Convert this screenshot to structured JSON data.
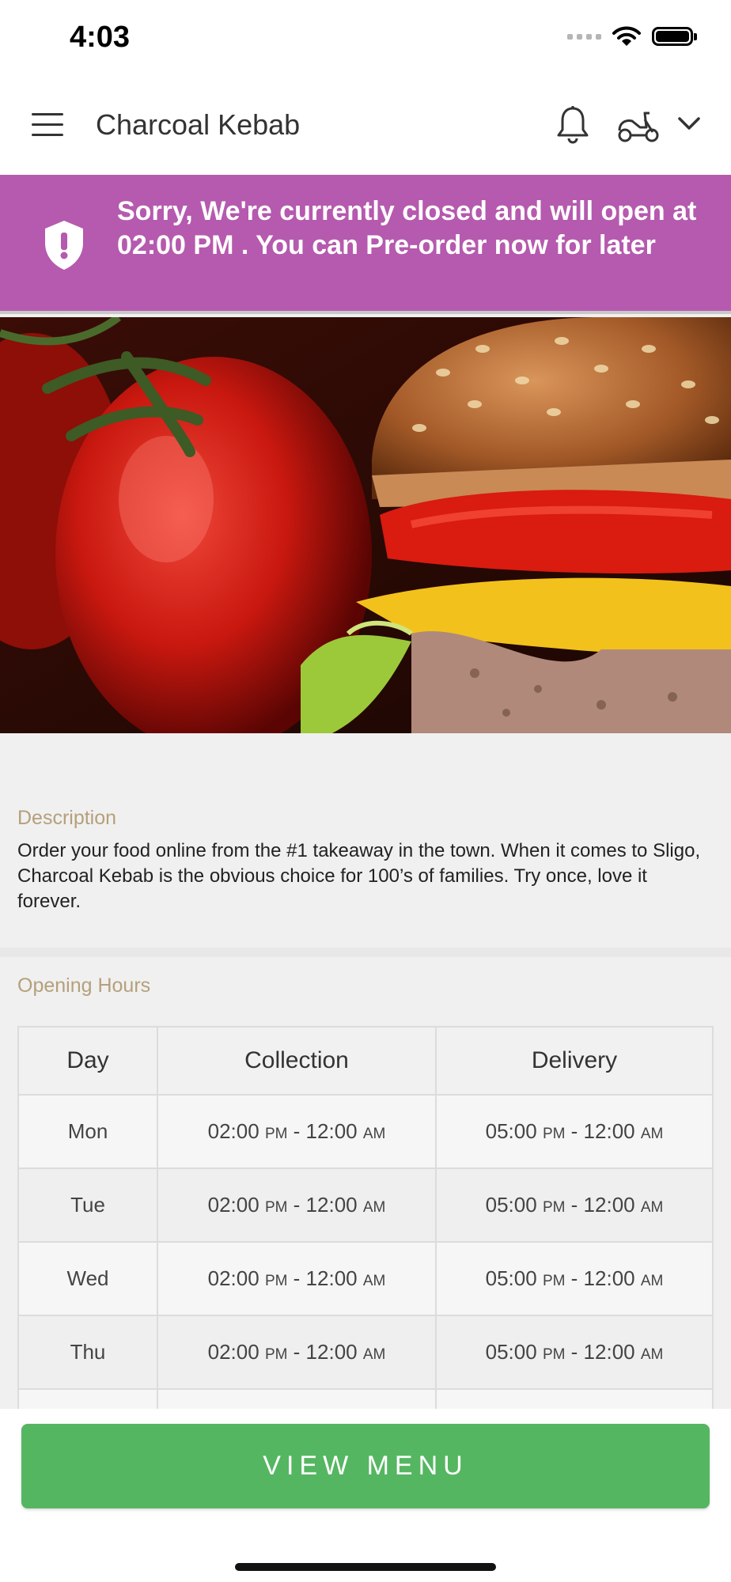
{
  "status_bar": {
    "time": "4:03",
    "icons": [
      "signal-icon",
      "wifi-icon",
      "battery-icon"
    ]
  },
  "header": {
    "title": "Charcoal Kebab",
    "icons": [
      "hamburger-menu-icon",
      "bell-icon",
      "scooter-icon",
      "chevron-down-icon"
    ]
  },
  "banner": {
    "text": "Sorry, We're currently closed and will open at 02:00 PM . You can Pre-order now for later",
    "icon": "shield-alert-icon",
    "color": "#b55aae"
  },
  "description": {
    "label": "Description",
    "text": "Order your food online from the #1 takeaway in the town. When it comes to Sligo, Charcoal Kebab is the obvious choice for 100’s of families. Try once, love it forever."
  },
  "opening_hours": {
    "label": "Opening Hours",
    "headers": [
      "Day",
      "Collection",
      "Delivery"
    ],
    "rows": [
      {
        "day": "Mon",
        "c_start": "02:00",
        "c_start_ap": "PM",
        "c_end": "12:00",
        "c_end_ap": "AM",
        "d_start": "05:00",
        "d_start_ap": "PM",
        "d_end": "12:00",
        "d_end_ap": "AM"
      },
      {
        "day": "Tue",
        "c_start": "02:00",
        "c_start_ap": "PM",
        "c_end": "12:00",
        "c_end_ap": "AM",
        "d_start": "05:00",
        "d_start_ap": "PM",
        "d_end": "12:00",
        "d_end_ap": "AM"
      },
      {
        "day": "Wed",
        "c_start": "02:00",
        "c_start_ap": "PM",
        "c_end": "12:00",
        "c_end_ap": "AM",
        "d_start": "05:00",
        "d_start_ap": "PM",
        "d_end": "12:00",
        "d_end_ap": "AM"
      },
      {
        "day": "Thu",
        "c_start": "02:00",
        "c_start_ap": "PM",
        "c_end": "12:00",
        "c_end_ap": "AM",
        "d_start": "05:00",
        "d_start_ap": "PM",
        "d_end": "12:00",
        "d_end_ap": "AM"
      }
    ]
  },
  "footer": {
    "button_label": "VIEW MENU",
    "button_color": "#55b661"
  }
}
